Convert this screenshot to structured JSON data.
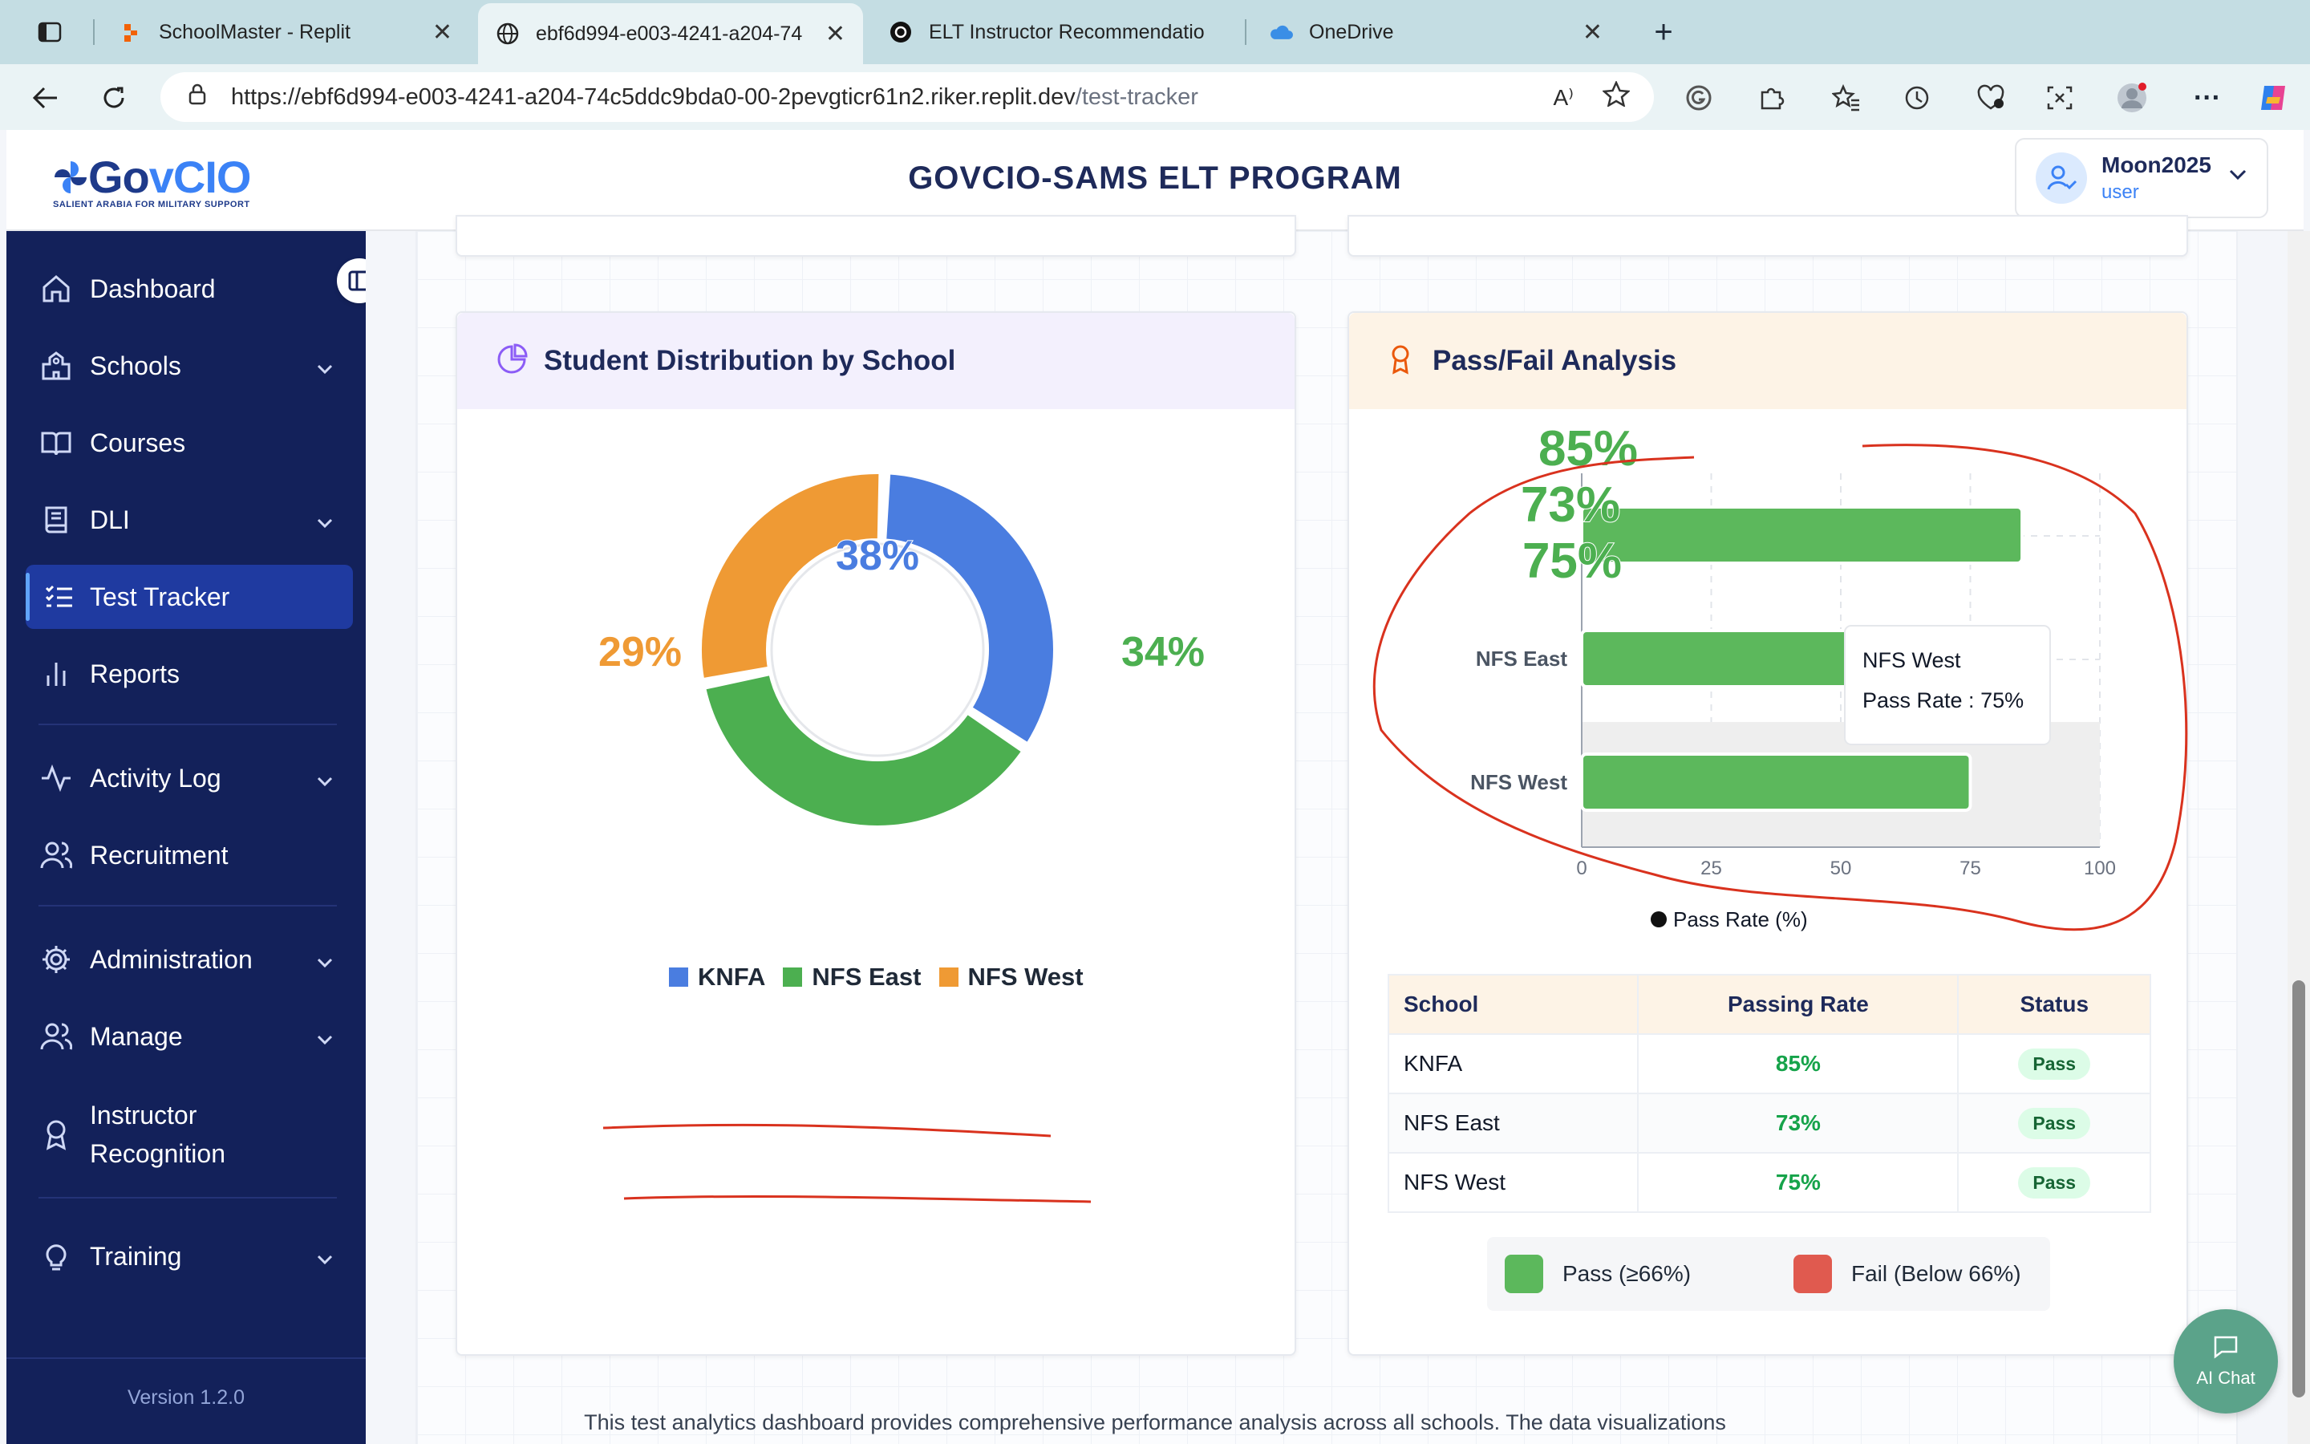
{
  "browser": {
    "tabs": [
      {
        "title": "SchoolMaster - Replit",
        "active": false
      },
      {
        "title": "ebf6d994-e003-4241-a204-74",
        "active": true
      },
      {
        "title": "ELT Instructor Recommendatio",
        "active": false
      },
      {
        "title": "OneDrive",
        "active": false
      }
    ],
    "url_base": "https://ebf6d994-e003-4241-a204-74c5ddc9bda0-00-2pevgticr61n2.riker.replit.dev",
    "url_path": "/test-tracker"
  },
  "header": {
    "logo_main_1": "Go",
    "logo_main_2": "v",
    "logo_main_3": "CIO",
    "logo_sub": "SALIENT ARABIA FOR MILITARY SUPPORT",
    "title": "GOVCIO-SAMS ELT PROGRAM",
    "user_name": "Moon2025",
    "user_role": "user"
  },
  "sidebar": {
    "items": [
      {
        "label": "Dashboard",
        "icon": "home-icon"
      },
      {
        "label": "Schools",
        "icon": "school-icon"
      },
      {
        "label": "Courses",
        "icon": "book-open-icon"
      },
      {
        "label": "DLI",
        "icon": "book-icon"
      },
      {
        "label": "Test Tracker",
        "icon": "list-check-icon"
      },
      {
        "label": "Reports",
        "icon": "bar-chart-icon"
      },
      {
        "label": "Activity Log",
        "icon": "activity-icon"
      },
      {
        "label": "Recruitment",
        "icon": "users-icon"
      },
      {
        "label": "Administration",
        "icon": "gear-icon"
      },
      {
        "label": "Manage",
        "icon": "users-icon"
      },
      {
        "label": "Instructor",
        "icon": "award-icon"
      },
      {
        "label": "Training",
        "icon": "lightbulb-icon"
      }
    ],
    "instructor_line2": "Recognition",
    "version": "Version 1.2.0"
  },
  "distribution": {
    "title": "Student Distribution by School",
    "legend": [
      "KNFA",
      "NFS East",
      "NFS West"
    ]
  },
  "passfail": {
    "title": "Pass/Fail Analysis",
    "overlay_labels": [
      "85%",
      "73%",
      "75%"
    ],
    "tooltip_title": "NFS West",
    "tooltip_value": "Pass Rate : 75%",
    "legend_label": "Pass Rate (%)",
    "table": {
      "headers": [
        "School",
        "Passing Rate",
        "Status"
      ],
      "rows": [
        {
          "school": "KNFA",
          "rate": "85%",
          "status": "Pass"
        },
        {
          "school": "NFS East",
          "rate": "73%",
          "status": "Pass"
        },
        {
          "school": "NFS West",
          "rate": "75%",
          "status": "Pass"
        }
      ]
    },
    "key_pass": "Pass (≥66%)",
    "key_fail": "Fail (Below 66%)"
  },
  "ai_chat_label": "AI Chat",
  "footer_text": "This test analytics dashboard provides comprehensive performance analysis across all schools. The data visualizations",
  "colors": {
    "sidebar_bg": "#13215a",
    "active_bg": "#1f3aa0",
    "knfa": "#4a7de0",
    "nfs_east": "#4caf50",
    "nfs_west": "#ef9a34",
    "pass_green": "#5cb85c",
    "fail_red": "#e05a4f",
    "annotation_red": "#d9321e"
  },
  "chart_data": [
    {
      "type": "pie",
      "title": "Student Distribution by School",
      "categories": [
        "KNFA",
        "NFS East",
        "NFS West"
      ],
      "values": [
        34,
        38,
        29
      ],
      "value_labels": [
        "34%",
        "38%",
        "29%"
      ],
      "legend": "bottom"
    },
    {
      "type": "bar",
      "orientation": "horizontal",
      "title": "Pass/Fail Analysis",
      "categories": [
        "KNFA",
        "NFS East",
        "NFS West"
      ],
      "series": [
        {
          "name": "Pass Rate (%)",
          "values": [
            85,
            73,
            75
          ]
        }
      ],
      "xlim": [
        0,
        100
      ],
      "xticks": [
        0,
        25,
        50,
        75,
        100
      ],
      "y_tick_labels_visible": [
        "NFS East",
        "NFS West"
      ],
      "legend": "bottom"
    }
  ]
}
